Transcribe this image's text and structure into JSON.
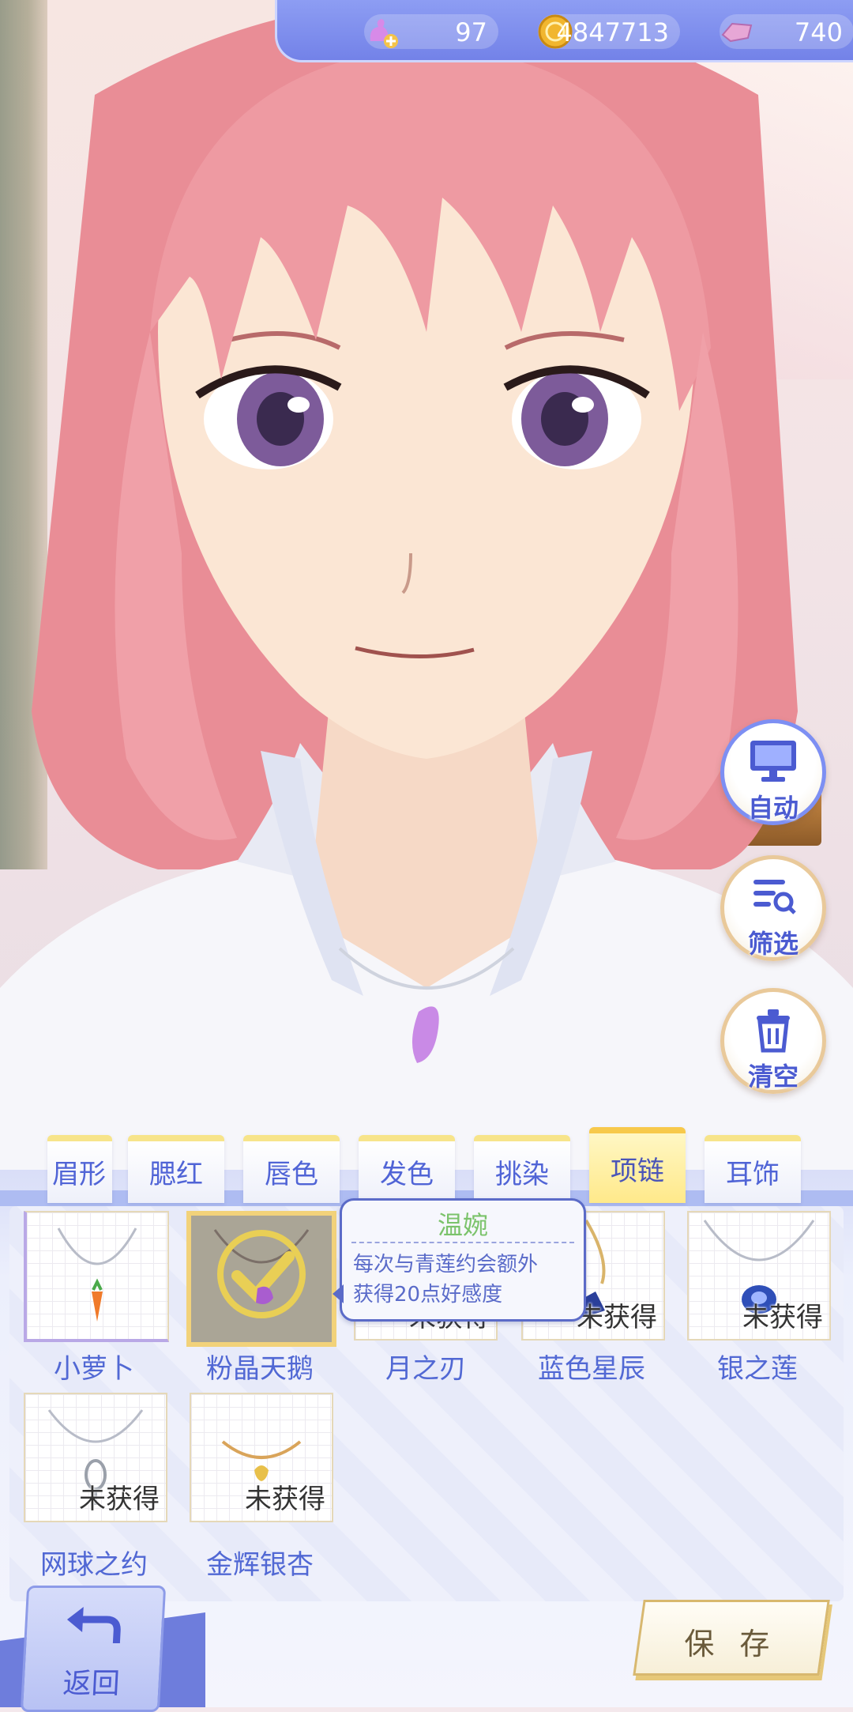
{
  "currency": {
    "swan_count": "97",
    "coins": "4847713",
    "crystals": "740"
  },
  "side_buttons": {
    "auto": "自动",
    "filter": "筛选",
    "clear": "清空"
  },
  "tabs": [
    {
      "label": "眉形",
      "active": false
    },
    {
      "label": "腮红",
      "active": false
    },
    {
      "label": "唇色",
      "active": false
    },
    {
      "label": "发色",
      "active": false
    },
    {
      "label": "挑染",
      "active": false
    },
    {
      "label": "项链",
      "active": true
    },
    {
      "label": "耳饰",
      "active": false
    }
  ],
  "items": [
    {
      "name": "小萝卜",
      "status": ""
    },
    {
      "name": "粉晶天鹅",
      "status": ""
    },
    {
      "name": "月之刃",
      "status": "未获得"
    },
    {
      "name": "蓝色星辰",
      "status": "未获得"
    },
    {
      "name": "银之莲",
      "status": "未获得"
    },
    {
      "name": "网球之约",
      "status": "未获得"
    },
    {
      "name": "金辉银杏",
      "status": "未获得"
    }
  ],
  "tooltip": {
    "title": "温婉",
    "line1": "每次与青莲约会额外",
    "line2": "获得20点好感度"
  },
  "back_label": "返回",
  "save_label": "保 存",
  "colors": {
    "accent": "#7382e8",
    "label_blue": "#5168d4",
    "tab_active": "#ffe98a",
    "tooltip_title": "#7bc36b"
  }
}
